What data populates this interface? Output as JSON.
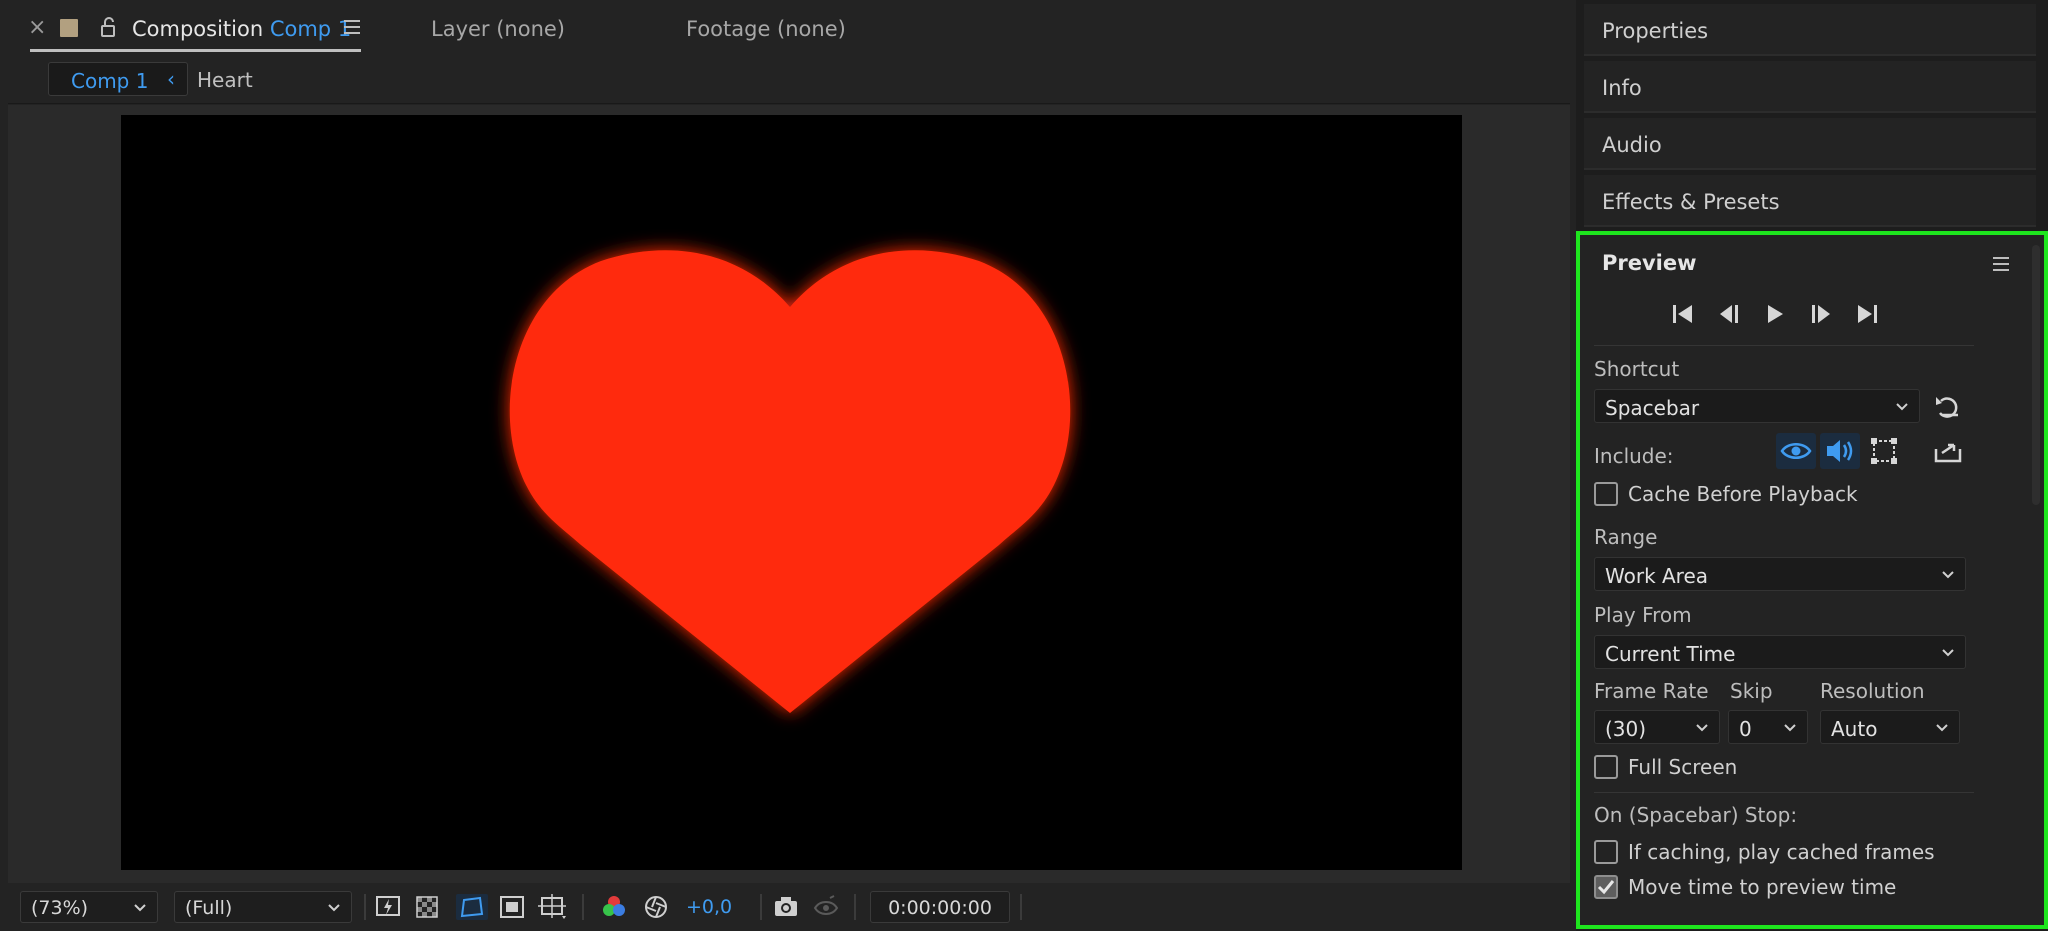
{
  "comp_panel": {
    "tab_close": "×",
    "tab_title_prefix": "Composition",
    "tab_title_name": "Comp 1",
    "tabs_other": [
      "Layer (none)",
      "Footage (none)"
    ],
    "breadcrumb_active": "Comp 1",
    "breadcrumb_chevron": "‹",
    "breadcrumb_next": "Heart",
    "viewer": {
      "shape": "heart",
      "shape_color": "#ff2a0a",
      "background": "#000000"
    },
    "bottom_bar": {
      "zoom": "(73%)",
      "resolution": "(Full)",
      "exposure": "+0,0",
      "timecode": "0:00:00:00"
    }
  },
  "side_panels": {
    "headers": [
      "Properties",
      "Info",
      "Audio",
      "Effects & Presets"
    ]
  },
  "preview": {
    "title": "Preview",
    "transport_icons": [
      "first-frame-icon",
      "previous-frame-icon",
      "play-icon",
      "next-frame-icon",
      "last-frame-icon"
    ],
    "shortcut_label": "Shortcut",
    "shortcut_value": "Spacebar",
    "include_label": "Include:",
    "cache_before_playback": "Cache Before Playback",
    "range_label": "Range",
    "range_value": "Work Area",
    "play_from_label": "Play From",
    "play_from_value": "Current Time",
    "frame_rate_label": "Frame Rate",
    "frame_rate_value": "(30)",
    "skip_label": "Skip",
    "skip_value": "0",
    "resolution_label": "Resolution",
    "resolution_value": "Auto",
    "full_screen": "Full Screen",
    "on_stop_label": "On (Spacebar) Stop:",
    "if_caching": "If caching, play cached frames",
    "move_time": "Move time to preview time",
    "checkbox_states": {
      "cache_before_playback": false,
      "full_screen": false,
      "if_caching": false,
      "move_time": true
    }
  },
  "colors": {
    "accent_blue": "#3f9bf0",
    "highlight_green": "#1ee51e"
  }
}
